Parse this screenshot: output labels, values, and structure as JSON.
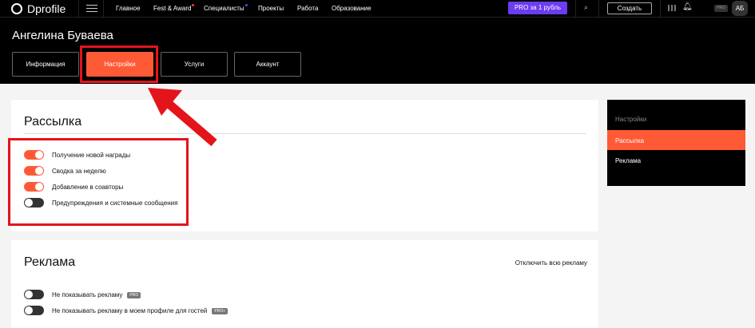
{
  "header": {
    "logo": "Dprofile",
    "nav": [
      "Главное",
      "Fest & Award",
      "Специалисты",
      "Проекты",
      "Работа",
      "Образование"
    ],
    "pro_button": "PRO за 1 рубль",
    "create_button": "Создать",
    "pro_badge": "PRO",
    "avatar": "АБ"
  },
  "profile": {
    "name": "Ангелина Буваева",
    "tabs": [
      "Информация",
      "Настройки",
      "Услуги",
      "Аккаунт"
    ]
  },
  "mailing": {
    "title": "Рассылка",
    "items": [
      {
        "label": "Получение новой награды",
        "on": true
      },
      {
        "label": "Сводка за неделю",
        "on": true
      },
      {
        "label": "Добавление в соавторы",
        "on": true
      },
      {
        "label": "Предупреждения и системные сообщения",
        "on": false
      }
    ]
  },
  "ads": {
    "title": "Реклама",
    "disable_all": "Отключить всю рекламу",
    "items": [
      {
        "label": "Не показывать рекламу",
        "badge": "PRO",
        "on": false
      },
      {
        "label": "Не показывать рекламу в моем профиле для гостей",
        "badge": "PRO+",
        "on": false
      }
    ]
  },
  "sidebar": {
    "title": "Настройки",
    "items": [
      "Рассылка",
      "Реклама"
    ]
  },
  "colors": {
    "accent": "#ff5a36",
    "pro": "#6b3cf0",
    "highlight": "#e4141b"
  }
}
